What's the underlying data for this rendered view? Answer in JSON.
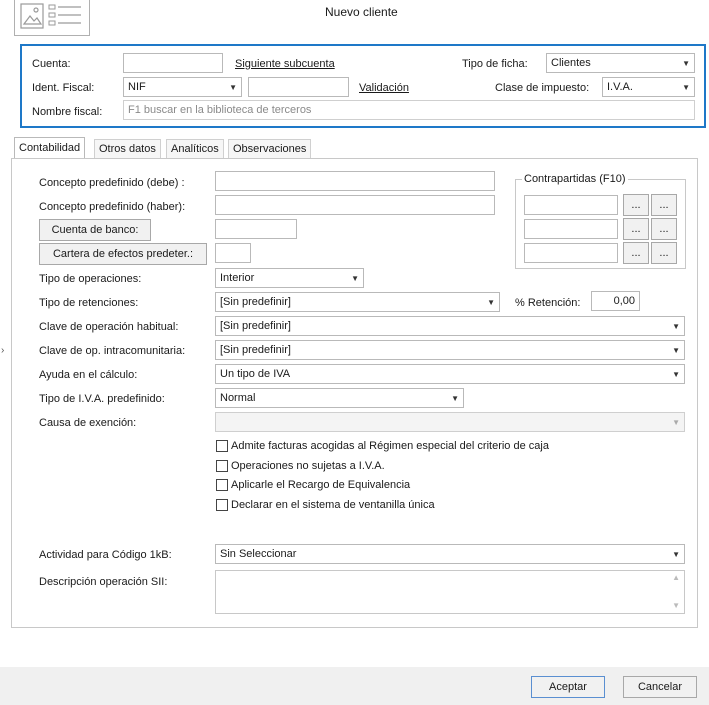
{
  "window": {
    "title": "Nuevo cliente",
    "logo": "document-card-icon"
  },
  "header": {
    "cuenta_label": "Cuenta:",
    "cuenta_value": "",
    "siguiente_link": "Siguiente subcuenta",
    "tipo_ficha_label": "Tipo de ficha:",
    "tipo_ficha_value": "Clientes",
    "ident_label": "Ident. Fiscal:",
    "ident_value": "NIF",
    "ident_number": "",
    "validacion_link": "Validación",
    "clase_label": "Clase de impuesto:",
    "clase_value": "I.V.A.",
    "nombre_label": "Nombre fiscal:",
    "nombre_placeholder": "F1 buscar en la biblioteca de terceros"
  },
  "tabs": [
    {
      "label": "Contabilidad",
      "active": true
    },
    {
      "label": "Otros datos",
      "active": false
    },
    {
      "label": "Analíticos",
      "active": false
    },
    {
      "label": "Observaciones",
      "active": false
    }
  ],
  "form": {
    "concepto_debe_label": "Concepto predefinido (debe) :",
    "concepto_haber_label": "Concepto predefinido (haber):",
    "cuenta_banco_button": "Cuenta de banco:",
    "cartera_button": "Cartera de efectos predeter.:",
    "contrapartidas_title": "Contrapartidas (F10)",
    "ellipsis": "...",
    "tipo_operaciones_label": "Tipo de operaciones:",
    "tipo_operaciones_value": "Interior",
    "tipo_retenciones_label": "Tipo de retenciones:",
    "tipo_retenciones_value": "[Sin predefinir]",
    "retencion_label": "% Retención:",
    "retencion_value": "0,00",
    "clave_habitual_label": "Clave de operación habitual:",
    "clave_habitual_value": "[Sin predefinir]",
    "clave_intra_label": "Clave de op. intracomunitaria:",
    "clave_intra_value": "[Sin predefinir]",
    "ayuda_label": "Ayuda en el cálculo:",
    "ayuda_value": "Un tipo de IVA",
    "tipo_iva_label": "Tipo de I.V.A. predefinido:",
    "tipo_iva_value": "Normal",
    "causa_label": "Causa de exención:",
    "causa_value": "",
    "checkboxes": [
      {
        "label": "Admite facturas acogidas al Régimen especial del criterio de caja",
        "checked": false
      },
      {
        "label": "Operaciones no sujetas a I.V.A.",
        "checked": false
      },
      {
        "label": "Aplicarle el Recargo de Equivalencia",
        "checked": false
      },
      {
        "label": "Declarar en el sistema de ventanilla única",
        "checked": false
      }
    ],
    "actividad_label": "Actividad para Código 1kB:",
    "actividad_value": "Sin Seleccionar",
    "descripcion_label": "Descripción operación SII:",
    "descripcion_value": ""
  },
  "footer": {
    "aceptar": "Aceptar",
    "cancelar": "Cancelar"
  },
  "colors": {
    "accent_border": "#1e78c8",
    "footer_bg": "#f0f0f0"
  }
}
